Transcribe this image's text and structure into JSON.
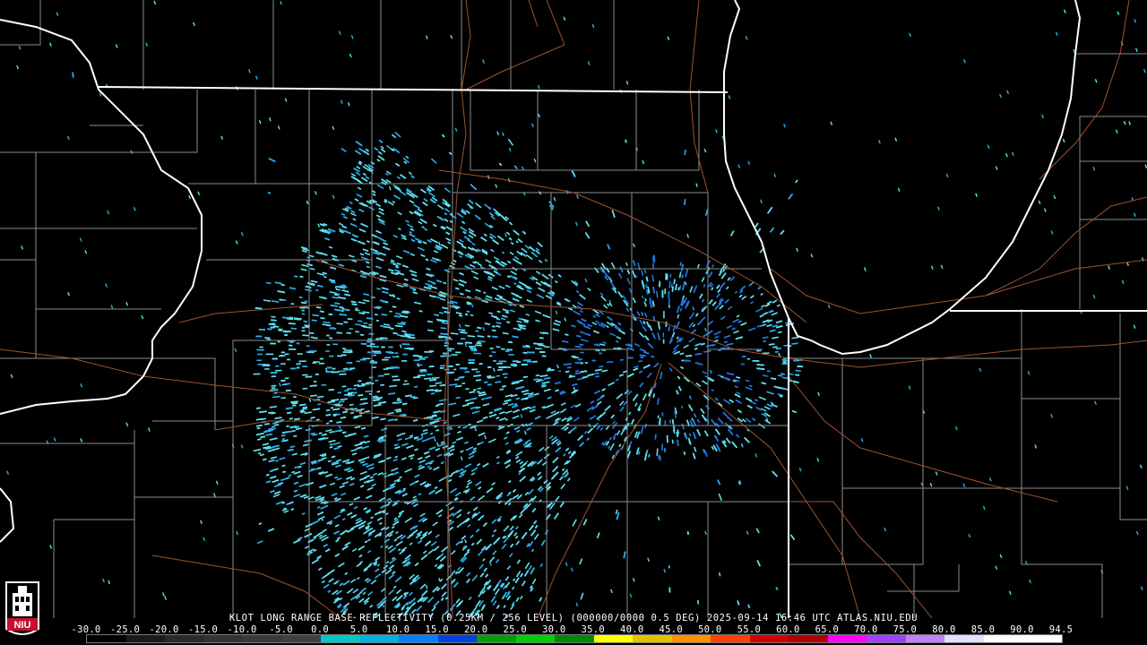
{
  "caption": {
    "radar": "KLOT",
    "product": "LONG RANGE BASE REFLECTIVITY",
    "resolution": "(0.25KM / 256 LEVEL)",
    "volume": "(000000/0000 0.5 DEG)",
    "timestamp": "2025-09-14 16:46 UTC",
    "source": "ATLAS.NIU.EDU"
  },
  "caption_text": "KLOT LONG RANGE BASE REFLECTIVITY (0.25KM / 256 LEVEL) (000000/0000 0.5 DEG) 2025-09-14 16:46 UTC  ATLAS.NIU.EDU",
  "logo": {
    "text": "NIU",
    "color": "#c8102e"
  },
  "colorbar": {
    "labels": [
      "-30.0",
      "-25.0",
      "-20.0",
      "-15.0",
      "-10.0",
      "-5.0",
      "0.0",
      "5.0",
      "10.0",
      "15.0",
      "20.0",
      "25.0",
      "30.0",
      "35.0",
      "40.0",
      "45.0",
      "50.0",
      "55.0",
      "60.0",
      "65.0",
      "70.0",
      "75.0",
      "80.0",
      "85.0",
      "90.0",
      "94.5"
    ],
    "colors": [
      "#000000",
      "#1a1a1a",
      "#2a2a2a",
      "#333333",
      "#3a3a3a",
      "#404040",
      "#00c8c8",
      "#00b0e0",
      "#0080ff",
      "#0040e0",
      "#00a000",
      "#00d000",
      "#008800",
      "#ffff00",
      "#e6c000",
      "#ff9000",
      "#ff4000",
      "#d00000",
      "#b00000",
      "#ff00ff",
      "#a040ff",
      "#c080ff",
      "#e0e0ff",
      "#ffffff",
      "#ffffff"
    ]
  },
  "map_colors": {
    "background": "#000000",
    "state_lines": "#ffffff",
    "county_lines": "#8c8c8c",
    "roads": "#a0522d",
    "echo_light": "#5fe0f0",
    "echo_mid": "#2aaee8",
    "echo_deep": "#1f78e0"
  },
  "radar_site": {
    "label": "KLOT"
  }
}
